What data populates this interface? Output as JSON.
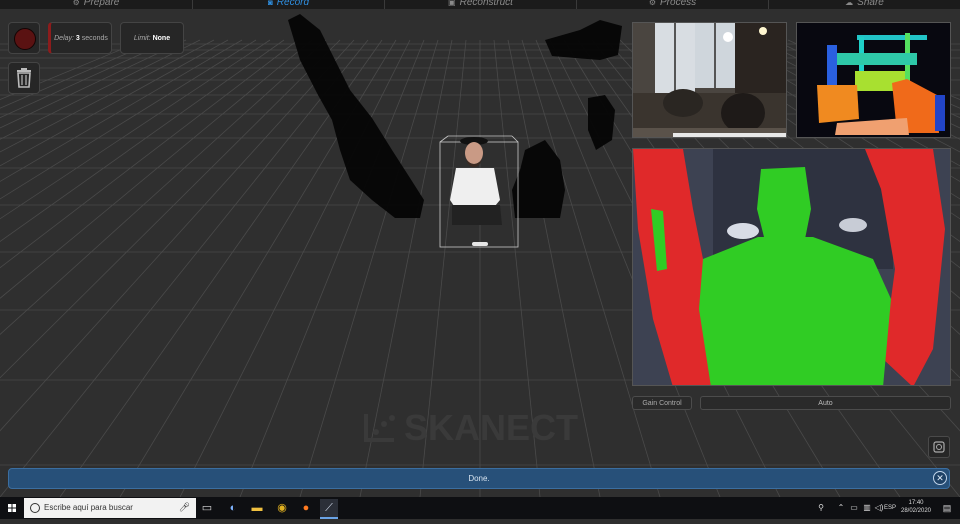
{
  "steps": [
    {
      "label": "Prepare",
      "icon": "gear-icon",
      "glyph": "⚙",
      "active": false
    },
    {
      "label": "Record",
      "icon": "record-icon",
      "glyph": "◙",
      "active": true
    },
    {
      "label": "Reconstruct",
      "icon": "reconstruct-icon",
      "glyph": "▣",
      "active": false
    },
    {
      "label": "Process",
      "icon": "process-icon",
      "glyph": "⚙",
      "active": false
    },
    {
      "label": "Share",
      "icon": "share-icon",
      "glyph": "☁",
      "active": false
    }
  ],
  "controls": {
    "delay_label": "Delay:",
    "delay_value": "3",
    "delay_unit": "seconds",
    "limit_label": "Limit:",
    "limit_value": "None"
  },
  "gain": {
    "label": "Gain Control",
    "value": "Auto"
  },
  "logo": {
    "text": "SKANECT"
  },
  "status": {
    "text": "Done.",
    "close_glyph": "✕"
  },
  "taskbar": {
    "search_placeholder": "Escribe aquí para buscar",
    "language": "ESP",
    "time": "17:40",
    "date": "28/02/2020"
  },
  "colors": {
    "accent": "#2f8fe0",
    "status_bar": "#275079",
    "record_button": "#5a1212",
    "segmentation_green": "#2ecc22",
    "segmentation_red": "#e02525"
  }
}
